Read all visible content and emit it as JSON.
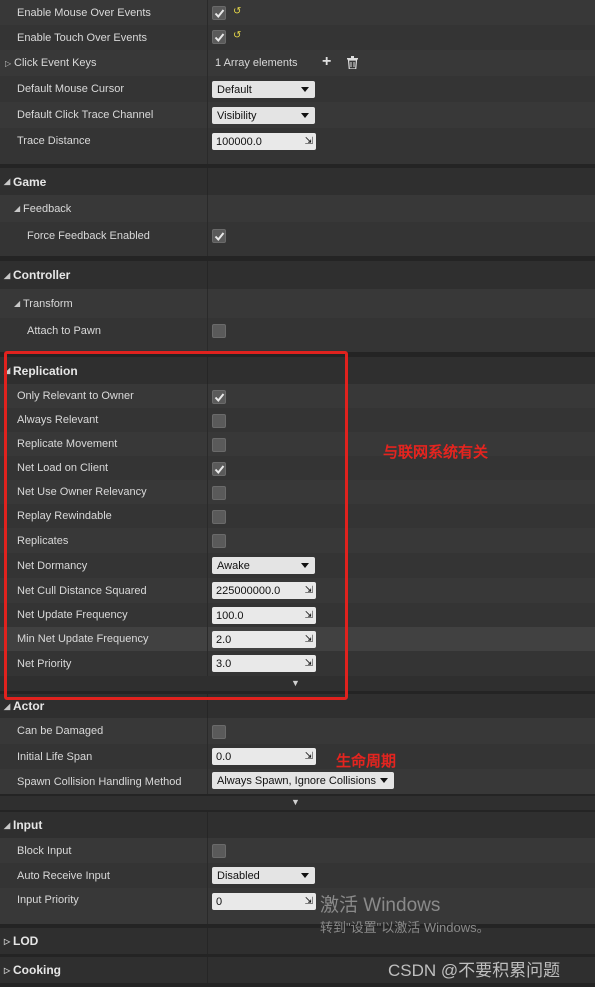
{
  "colors": {
    "accent_red": "#e0221e",
    "reset_arrow": "#e8d94a"
  },
  "rows": {
    "enable_mouse_over": {
      "label": "Enable Mouse Over Events",
      "checked": true
    },
    "enable_touch_over": {
      "label": "Enable Touch Over Events",
      "checked": true
    },
    "click_event_keys": {
      "label": "Click Event Keys",
      "value": "1 Array elements"
    },
    "default_mouse_cursor": {
      "label": "Default Mouse Cursor",
      "value": "Default"
    },
    "default_click_trace": {
      "label": "Default Click Trace Channel",
      "value": "Visibility"
    },
    "trace_distance": {
      "label": "Trace Distance",
      "value": "100000.0"
    }
  },
  "game": {
    "title": "Game",
    "feedback": "Feedback",
    "force_feedback": {
      "label": "Force Feedback Enabled",
      "checked": true
    }
  },
  "controller": {
    "title": "Controller",
    "transform": "Transform",
    "attach_to_pawn": {
      "label": "Attach to Pawn",
      "checked": false
    }
  },
  "replication": {
    "title": "Replication",
    "only_relevant_to_owner": {
      "label": "Only Relevant to Owner",
      "checked": true
    },
    "always_relevant": {
      "label": "Always Relevant",
      "checked": false
    },
    "replicate_movement": {
      "label": "Replicate Movement",
      "checked": false
    },
    "net_load_on_client": {
      "label": "Net Load on Client",
      "checked": true
    },
    "net_use_owner_relevancy": {
      "label": "Net Use Owner Relevancy",
      "checked": false
    },
    "replay_rewindable": {
      "label": "Replay Rewindable",
      "checked": false
    },
    "replicates": {
      "label": "Replicates",
      "checked": false
    },
    "net_dormancy": {
      "label": "Net Dormancy",
      "value": "Awake"
    },
    "net_cull_distance": {
      "label": "Net Cull Distance Squared",
      "value": "225000000.0"
    },
    "net_update_freq": {
      "label": "Net Update Frequency",
      "value": "100.0"
    },
    "min_net_update_freq": {
      "label": "Min Net Update Frequency",
      "value": "2.0"
    },
    "net_priority": {
      "label": "Net Priority",
      "value": "3.0"
    }
  },
  "actor": {
    "title": "Actor",
    "can_be_damaged": {
      "label": "Can be Damaged",
      "checked": false
    },
    "initial_life_span": {
      "label": "Initial Life Span",
      "value": "0.0"
    },
    "spawn_collision": {
      "label": "Spawn Collision Handling Method",
      "value": "Always Spawn, Ignore Collisions"
    }
  },
  "input": {
    "title": "Input",
    "block_input": {
      "label": "Block Input",
      "checked": false
    },
    "auto_receive_input": {
      "label": "Auto Receive Input",
      "value": "Disabled"
    },
    "input_priority": {
      "label": "Input Priority",
      "value": "0"
    }
  },
  "lod": {
    "title": "LOD"
  },
  "cooking": {
    "title": "Cooking"
  },
  "annotations": {
    "network": "与联网系统有关",
    "lifecycle": "生命周期"
  },
  "watermark": {
    "line1": "激活 Windows",
    "line2": "转到\"设置\"以激活 Windows。",
    "csdn": "CSDN @不要积累问题"
  }
}
